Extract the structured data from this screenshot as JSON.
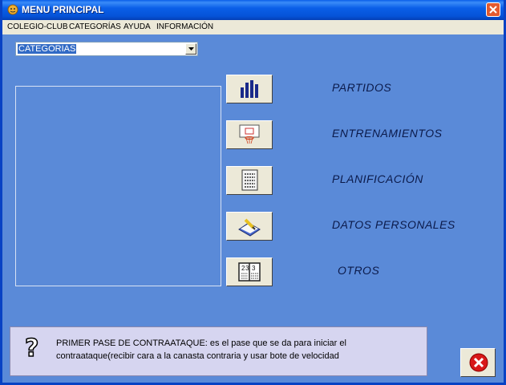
{
  "window": {
    "title": "MENU PRINCIPAL"
  },
  "menu": [
    "COLEGIO-CLUB",
    "CATEGORÍAS",
    "AYUDA",
    "INFORMACIÓN"
  ],
  "combo": {
    "value": "CATEGORIAS"
  },
  "options": [
    {
      "label": "PARTIDOS",
      "icon": "bar-chart-icon"
    },
    {
      "label": "ENTRENAMIENTOS",
      "icon": "basketball-hoop-icon"
    },
    {
      "label": "PLANIFICACIÓN",
      "icon": "document-list-icon"
    },
    {
      "label": "DATOS PERSONALES",
      "icon": "notepad-pen-icon"
    },
    {
      "label": "OTROS",
      "icon": "calendar-book-icon"
    }
  ],
  "tip": {
    "text": "PRIMER PASE DE CONTRAATAQUE: es el pase que se da para iniciar el contraataque(recibir cara a la canasta contraria y usar bote de velocidad",
    "icon": "question-icon"
  },
  "exit": {
    "icon": "exit-x-icon"
  },
  "colors": {
    "background": "#5a8ad8",
    "titlebar": "#0a5fe8",
    "tip_background": "#d6d5f0"
  }
}
